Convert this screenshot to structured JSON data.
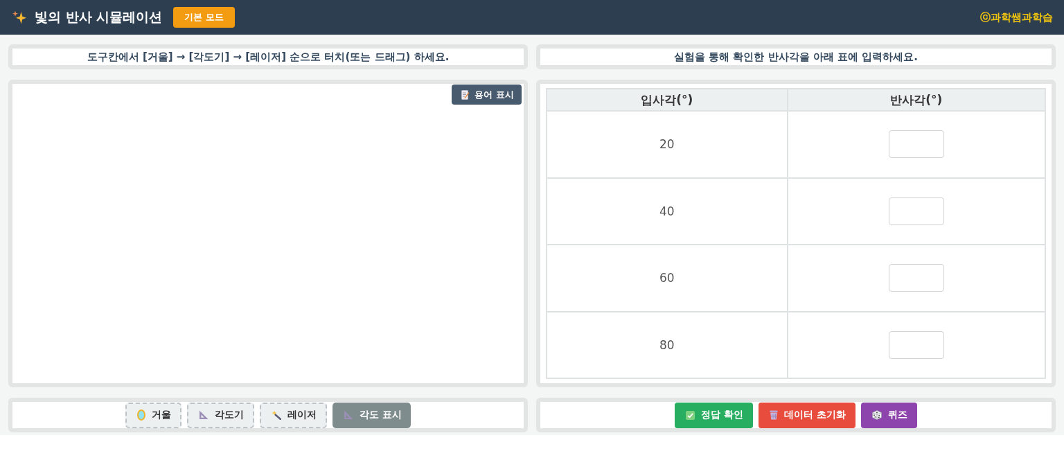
{
  "header": {
    "title": "빛의 반사 시뮬레이션",
    "mode_button": "기본 모드",
    "credit": "ⓒ과학쌤과학습"
  },
  "simulation": {
    "instruction": "도구칸에서 [거울] → [각도기] → [레이저] 순으로 터치(또는 드래그) 하세요.",
    "term_button": "용어 표시",
    "tools": [
      {
        "kind": "tool",
        "label": "거울"
      },
      {
        "kind": "tool",
        "label": "각도기"
      },
      {
        "kind": "tool",
        "label": "레이저"
      },
      {
        "kind": "toggle",
        "label": "각도 표시"
      }
    ]
  },
  "results": {
    "instruction": "실험을 통해 확인한 반사각을 아래 표에 입력하세요.",
    "table": {
      "columns": [
        "입사각(°)",
        "반사각(°)"
      ],
      "rows": [
        {
          "incident_angle": "20"
        },
        {
          "incident_angle": "40"
        },
        {
          "incident_angle": "60"
        },
        {
          "incident_angle": "80"
        }
      ]
    },
    "actions": [
      {
        "label": "정답 확인",
        "color": "#27ae60"
      },
      {
        "label": "데이터 초기화",
        "color": "#e74c3c"
      },
      {
        "label": "퀴즈",
        "color": "#8e44ad"
      }
    ]
  }
}
